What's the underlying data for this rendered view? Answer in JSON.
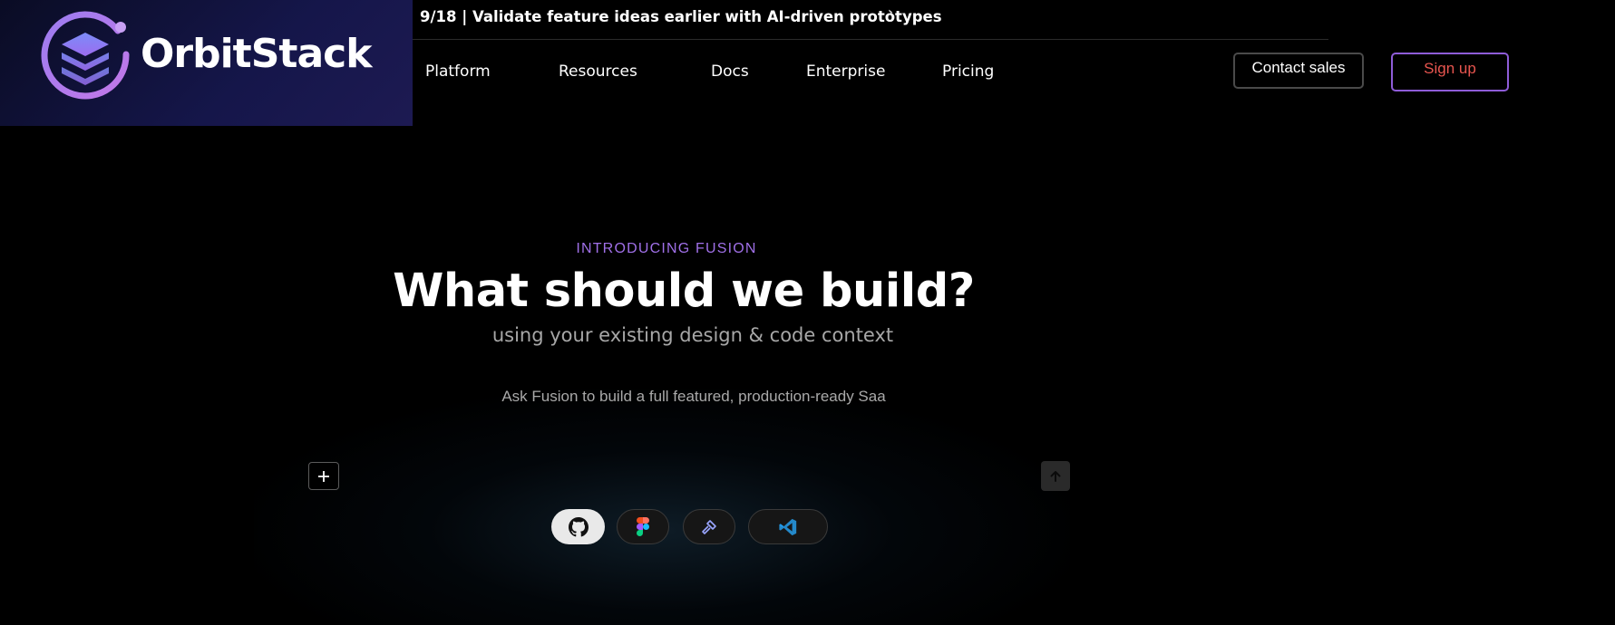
{
  "brand": {
    "name": "OrbitStack"
  },
  "announcement": {
    "text": "9/18 | Validate feature ideas earlier with AI-driven prototypes"
  },
  "nav": {
    "items": [
      {
        "label": "Platform"
      },
      {
        "label": "Resources"
      },
      {
        "label": "Docs"
      },
      {
        "label": "Enterprise"
      },
      {
        "label": "Pricing"
      }
    ],
    "contact_label": "Contact sales",
    "signup_label": "Sign up"
  },
  "hero": {
    "eyebrow": "INTRODUCING FUSION",
    "headline": "What should we build?",
    "subhead": "using your existing design & code context",
    "prompt_placeholder": "Ask Fusion to build a full featured, production-ready Saa"
  },
  "integrations": [
    {
      "icon": "github-icon"
    },
    {
      "icon": "figma-icon"
    },
    {
      "icon": "builder-icon"
    },
    {
      "icon": "vscode-icon"
    }
  ],
  "colors": {
    "accent_purple": "#a070e8",
    "signup_text": "#e8554f",
    "signup_border": "#8e5cd8"
  }
}
